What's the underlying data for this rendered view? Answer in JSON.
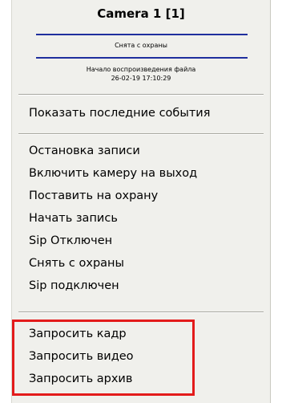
{
  "header": {
    "title": "Camera 1 [1]",
    "status": "Снята с охраны",
    "file_line1": "Начало воспроизведения файла",
    "file_line2": "26-02-19 17:10:29"
  },
  "menu": {
    "group1": [
      "Показать последние события"
    ],
    "group2": [
      "Остановка записи",
      "Включить камеру на выход",
      "Поставить на охрану",
      "Начать запись",
      "Sip Отключен",
      "Снять с охраны",
      "Sip подключен"
    ],
    "group3": [
      "Запросить кадр",
      "Запросить видео",
      "Запросить архив"
    ]
  },
  "colors": {
    "accent_bar": "#1f2f9e",
    "highlight_border": "#e31b1b",
    "menu_bg": "#f0f0ec"
  }
}
